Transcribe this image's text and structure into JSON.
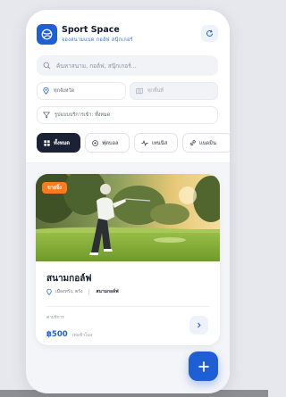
{
  "header": {
    "title": "Sport Space",
    "subtitle": "จองสนามแบด กอล์ฟ สนุ๊กเกอร์",
    "brand_color": "#1f5fd6"
  },
  "search": {
    "placeholder": "ค้นหาสนาม, กอล์ฟ, สนุ๊กเกอร์..."
  },
  "filters": {
    "province": "ทุกจังหวัด",
    "district": "ทุกพื้นที่",
    "service_type": "รูปแบบบริการเข้า: ทั้งหมด"
  },
  "categories": [
    {
      "label": "ทั้งหมด",
      "icon": "grid-icon",
      "active": true
    },
    {
      "label": "ฟุตบอล",
      "icon": "soccer-ball-icon",
      "active": false
    },
    {
      "label": "เทนนิส",
      "icon": "activity-icon",
      "active": false
    },
    {
      "label": "แบดมิน",
      "icon": "shuttlecock-icon",
      "active": false
    }
  ],
  "venue": {
    "badge": "ขายจิ้ง",
    "badge_color": "#ff7a1a",
    "name": "สนามกอล์ฟ",
    "location": "เมืองทรัง, ตรัง",
    "type": "สนามกอล์ฟ",
    "price_label": "ค่าบริการ",
    "price": "฿500",
    "price_unit": "/ต่อชั่วโมง"
  }
}
